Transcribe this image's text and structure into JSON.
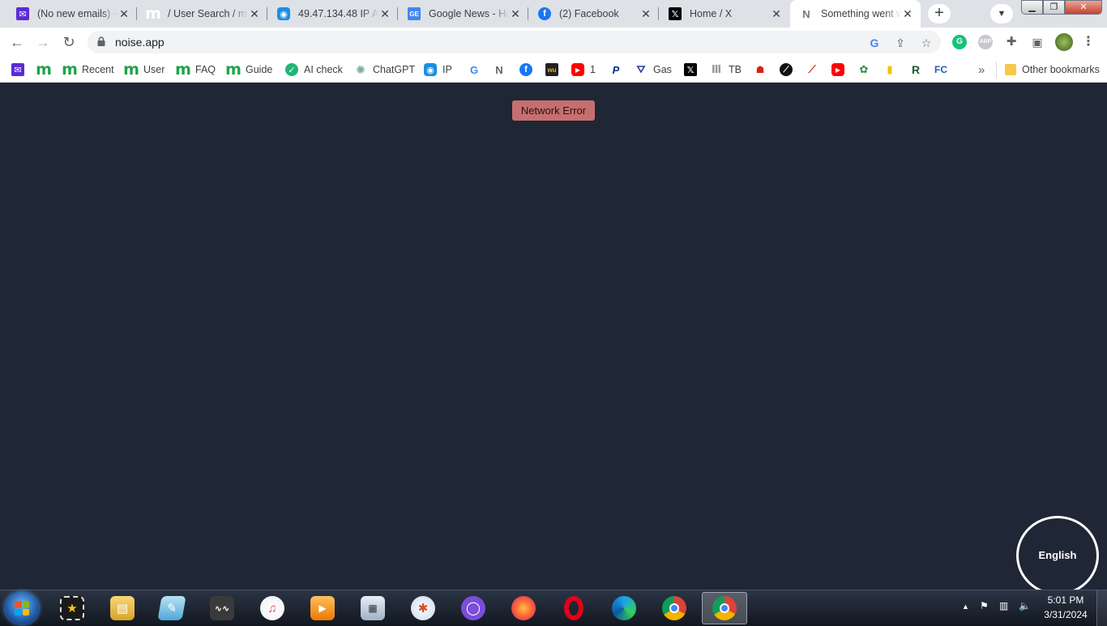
{
  "browser": {
    "tabs": [
      {
        "title": "(No new emails) - ",
        "icon": "mail-icon",
        "color": "#5b2bd6"
      },
      {
        "title": "/ User Search / my",
        "icon": "m-logo-icon",
        "color": "#1ea34a"
      },
      {
        "title": "49.47.134.48 IP Ad",
        "icon": "location-pin-icon",
        "color": "#1a8fe3"
      },
      {
        "title": "Google News - He",
        "icon": "google-news-icon",
        "color": "#4285f4"
      },
      {
        "title": "(2) Facebook",
        "icon": "facebook-icon",
        "color": "#1877f2"
      },
      {
        "title": "Home / X",
        "icon": "x-logo-icon",
        "color": "#000000"
      },
      {
        "title": "Something went w",
        "icon": "noise-logo-icon",
        "color": "#777777"
      }
    ],
    "url": "noise.app",
    "bookmarks": [
      {
        "label": "",
        "icon": "mail-icon"
      },
      {
        "label": "",
        "icon": "m-logo-icon"
      },
      {
        "label": "Recent",
        "icon": "m-logo-icon"
      },
      {
        "label": "User",
        "icon": "m-logo-icon"
      },
      {
        "label": "FAQ",
        "icon": "m-logo-icon"
      },
      {
        "label": "Guide",
        "icon": "m-logo-icon"
      },
      {
        "label": "AI check",
        "icon": "check-badge-icon"
      },
      {
        "label": "ChatGPT",
        "icon": "chatgpt-icon"
      },
      {
        "label": "IP",
        "icon": "location-pin-icon"
      },
      {
        "label": "",
        "icon": "google-icon"
      },
      {
        "label": "",
        "icon": "noise-logo-icon"
      },
      {
        "label": "",
        "icon": "facebook-icon"
      },
      {
        "label": "",
        "icon": "wu-icon"
      },
      {
        "label": "1",
        "icon": "youtube-icon"
      },
      {
        "label": "",
        "icon": "paypal-icon"
      },
      {
        "label": "Gas",
        "icon": "gas-icon"
      },
      {
        "label": "",
        "icon": "x-logo-icon"
      },
      {
        "label": "TB",
        "icon": "pillar-icon"
      },
      {
        "label": "",
        "icon": "statefarm-icon"
      },
      {
        "label": "",
        "icon": "compass-icon"
      },
      {
        "label": "",
        "icon": "swoosh-icon"
      },
      {
        "label": "",
        "icon": "youtube-icon"
      },
      {
        "label": "",
        "icon": "leaf-icon"
      },
      {
        "label": "",
        "icon": "bars-icon"
      },
      {
        "label": "R",
        "icon": "r-logo-icon"
      },
      {
        "label": "FC",
        "icon": "fc-logo-icon"
      }
    ],
    "more_bookmarks": "»",
    "other_bookmarks": "Other bookmarks"
  },
  "page": {
    "error_message": "Network Error",
    "language": "English"
  },
  "taskbar": {
    "time": "5:01 PM",
    "date": "3/31/2024"
  }
}
